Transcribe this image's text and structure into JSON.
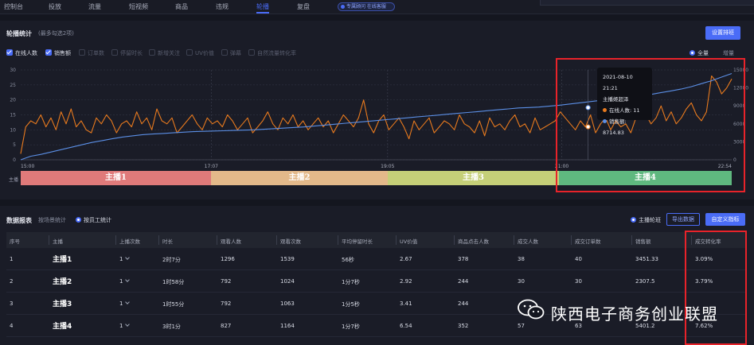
{
  "nav": {
    "items": [
      "控制台",
      "投放",
      "流量",
      "短视频",
      "商品",
      "违规",
      "轮播",
      "复盘"
    ],
    "active_index": 6,
    "help": "专属顾问 在线客服"
  },
  "carousel": {
    "title": "轮播统计",
    "hint": "(最多勾选2项)",
    "set_button": "设置排班",
    "metrics": [
      {
        "label": "在线人数",
        "checked": true
      },
      {
        "label": "销售额",
        "checked": true
      },
      {
        "label": "订单数",
        "checked": false
      },
      {
        "label": "停留时长",
        "checked": false
      },
      {
        "label": "新增关注",
        "checked": false
      },
      {
        "label": "UV价值",
        "checked": false
      },
      {
        "label": "弹幕",
        "checked": false
      },
      {
        "label": "自然流量转化率",
        "checked": false
      }
    ],
    "view": {
      "all": "全量",
      "inc": "增量"
    },
    "anchor_label": "主播",
    "segments": [
      {
        "name": "主播1",
        "color": "#e07a7a"
      },
      {
        "name": "主播2",
        "color": "#e3b98a"
      },
      {
        "name": "主播3",
        "color": "#c5cf78"
      },
      {
        "name": "主播4",
        "color": "#5fb87f"
      }
    ],
    "tooltip": {
      "time": "2021-08-10 21:21",
      "anchor": "主播姬超泽",
      "online_label": "在线人数:",
      "online_value": "11",
      "sales_label": "销售额:",
      "sales_value": "8714.83"
    }
  },
  "chart_data": {
    "type": "line",
    "x_ticks": [
      "15:00",
      "17:07",
      "19:05",
      "21:00",
      "22:54"
    ],
    "y_left_ticks": [
      "0",
      "5",
      "10",
      "15",
      "20",
      "25",
      "30"
    ],
    "y_right_ticks": [
      "0",
      "3000",
      "6000",
      "9000",
      "12000",
      "15000"
    ],
    "y_left_range": [
      0,
      30
    ],
    "y_right_range": [
      0,
      15000
    ],
    "grid": true,
    "series": [
      {
        "name": "在线人数",
        "axis": "left",
        "color": "#e87a1e",
        "values": [
          2,
          11,
          13,
          12,
          15,
          11,
          14,
          10,
          16,
          12,
          17,
          11,
          13,
          10,
          9,
          14,
          12,
          15,
          13,
          9,
          12,
          13,
          11,
          16,
          12,
          14,
          10,
          17,
          13,
          12,
          14,
          9,
          11,
          13,
          15,
          12,
          10,
          14,
          12,
          13,
          11,
          15,
          13,
          10,
          12,
          14,
          9,
          11,
          13,
          16,
          12,
          10,
          14,
          12,
          15,
          11,
          13,
          10,
          12,
          14,
          11,
          13,
          9,
          12,
          15,
          13,
          11,
          14,
          20,
          12,
          9,
          13,
          15,
          10,
          12,
          14,
          11,
          7,
          13,
          10,
          12,
          14,
          9,
          11,
          13,
          12,
          10,
          15,
          12,
          11,
          9,
          13,
          8,
          14,
          11,
          12,
          10,
          13,
          15,
          11,
          12,
          9,
          14,
          10,
          11,
          12,
          13,
          16,
          14,
          12,
          10,
          13,
          11,
          15,
          9,
          12,
          14,
          10,
          13,
          11,
          12,
          9,
          14,
          17,
          15,
          12,
          14,
          18,
          13,
          16,
          12,
          14,
          17,
          19,
          15,
          13,
          16,
          28,
          26,
          22,
          24,
          27
        ]
      },
      {
        "name": "销售额",
        "axis": "right",
        "color": "#5b8fe6",
        "values": [
          0,
          600,
          900,
          1300,
          1700,
          2100,
          2500,
          2900,
          3200,
          3500,
          3800,
          4000,
          4200,
          4300,
          4400,
          4500,
          4600,
          4700,
          4750,
          4800,
          4850,
          4900,
          4950,
          5000,
          5100,
          5200,
          5300,
          5400,
          5500,
          5650,
          5800,
          5950,
          6100,
          6250,
          6400,
          6550,
          6700,
          6850,
          7000,
          7150,
          7300,
          7450,
          7600,
          7750,
          7900,
          8050,
          8200,
          8350,
          8500,
          8650,
          8714.83,
          8800,
          8950,
          9100,
          9300,
          9500,
          9700,
          9900,
          10100,
          10300,
          10500,
          10700,
          10900,
          11200,
          11500,
          11800,
          12200,
          12700,
          13200,
          13800,
          14400
        ]
      }
    ]
  },
  "report": {
    "title": "数据报表",
    "radio_single": "按场景统计",
    "radio_work": "按员工统计",
    "radio_right": "主播轮班",
    "export": "导出数据",
    "custom": "自定义指标",
    "headers": [
      "序号",
      "主播",
      "上播次数",
      "时长",
      "观看人数",
      "观看次数",
      "平均停留时长",
      "UV价值",
      "商品点击人数",
      "成交人数",
      "成交订单数",
      "销售额",
      "成交转化率"
    ],
    "rows": [
      [
        "1",
        "主播1",
        "1",
        "2时7分",
        "1296",
        "1539",
        "56秒",
        "2.67",
        "378",
        "38",
        "40",
        "3451.33",
        "3.09%"
      ],
      [
        "2",
        "主播2",
        "1",
        "1时58分",
        "792",
        "1024",
        "1分7秒",
        "2.92",
        "244",
        "30",
        "30",
        "2307.5",
        "3.79%"
      ],
      [
        "3",
        "主播3",
        "1",
        "1时55分",
        "792",
        "1063",
        "1分5秒",
        "3.41",
        "244",
        "",
        "",
        "",
        ""
      ],
      [
        "4",
        "主播4",
        "1",
        "3时1分",
        "827",
        "1164",
        "1分7秒",
        "6.54",
        "352",
        "57",
        "63",
        "5401.2",
        "7.62%"
      ]
    ]
  },
  "watermark": "陕西电子商务创业联盟"
}
